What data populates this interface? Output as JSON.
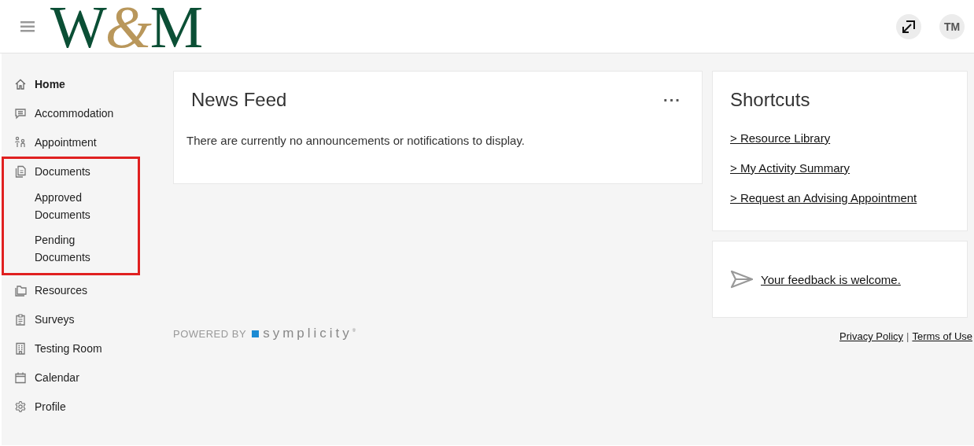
{
  "header": {
    "logo": [
      {
        "text": "W",
        "accent": false
      },
      {
        "text": "&",
        "accent": true
      },
      {
        "text": "M",
        "accent": false
      }
    ],
    "avatar": "TM"
  },
  "sidebar": {
    "items": [
      {
        "label": "Home",
        "kind": "home",
        "selected": true,
        "highlighted": false
      },
      {
        "label": "Accommodation",
        "kind": "chat",
        "selected": false,
        "highlighted": false
      },
      {
        "label": "Appointment",
        "kind": "people",
        "selected": false,
        "highlighted": false
      },
      {
        "label": "Documents",
        "kind": "document",
        "selected": false,
        "highlighted": true,
        "children": [
          {
            "label": "Approved Documents",
            "selected": false
          },
          {
            "label": "Pending Documents",
            "selected": false
          }
        ]
      },
      {
        "label": "Resources",
        "kind": "folder",
        "selected": false,
        "highlighted": false
      },
      {
        "label": "Surveys",
        "kind": "clipboard",
        "selected": false,
        "highlighted": false
      },
      {
        "label": "Testing Room",
        "kind": "building",
        "selected": false,
        "highlighted": false
      },
      {
        "label": "Calendar",
        "kind": "calendar",
        "selected": false,
        "highlighted": false
      },
      {
        "label": "Profile",
        "kind": "gear",
        "selected": false,
        "highlighted": false
      }
    ]
  },
  "news_feed": {
    "title": "News Feed",
    "menu": "···",
    "message": "There are currently no announcements or notifications to display."
  },
  "powered_by": {
    "label": "POWERED BY",
    "brand": "symplicity$^{®}$"
  },
  "shortcuts": {
    "title": "Shortcuts",
    "links": [
      "> Resource Library",
      "> My Activity Summary",
      "> Request an Advising Appointment"
    ]
  },
  "feedback": {
    "link": "Your feedback is welcome."
  },
  "footer": {
    "links": [
      "Privacy Policy",
      "Terms of Use"
    ],
    "separator": "|"
  }
}
